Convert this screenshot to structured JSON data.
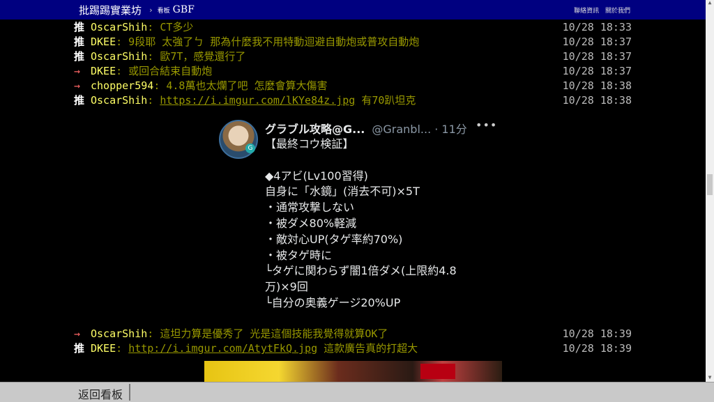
{
  "header": {
    "board_title": "批踢踢實業坊",
    "separator": "›",
    "board_label": "看板",
    "board_name": "GBF",
    "links": [
      "聯絡資訊",
      "關於我們"
    ]
  },
  "pushes_top": [
    {
      "tag": "推",
      "user": "OscarShih",
      "content": ": CT多少",
      "time": "10/28 18:33"
    },
    {
      "tag": "推",
      "user": "DKEE",
      "content": ": 9段耶 太強了ㄅ 那為什麼我不用特動迴避自動炮或普攻自動炮",
      "time": "10/28 18:37"
    },
    {
      "tag": "推",
      "user": "OscarShih",
      "content": ": 歐7T，感覺還行了",
      "time": "10/28 18:37"
    },
    {
      "tag": "→",
      "user": "DKEE",
      "content": ": 或回合結束自動炮",
      "time": "10/28 18:37"
    },
    {
      "tag": "→",
      "user": "chopper594",
      "content": ": 4.8萬也太爛了吧  怎麼會算大傷害",
      "time": "10/28 18:38"
    },
    {
      "tag": "推",
      "user": "OscarShih",
      "content": ": ",
      "link": "https://i.imgur.com/lKYe84z.jpg",
      "after": " 有70趴坦克",
      "time": "10/28 18:38"
    }
  ],
  "tweet": {
    "name": "グラブル攻略@G...",
    "handle": "@Granbl... · 11分",
    "more": "•••",
    "avatar_badge": "G",
    "lines": [
      "【最終コウ検証】",
      "",
      "◆4アビ(Lv100習得)",
      "自身に「水鏡」(消去不可)×5T",
      "・通常攻撃しない",
      "・被ダメ80%軽減",
      "・敵対心UP(タゲ率約70%)",
      "・被タゲ時に",
      "└タゲに関わらず闇1倍ダメ(上限約4.8",
      "万)×9回",
      "└自分の奥義ゲージ20%UP"
    ]
  },
  "pushes_bottom": [
    {
      "tag": "→",
      "user": "OscarShih",
      "content": ": 這坦力算是優秀了 光是這個技能我覺得就算OK了",
      "time": "10/28 18:39"
    },
    {
      "tag": "推",
      "user": "DKEE",
      "content": ": ",
      "link": "http://i.imgur.com/AtytFkQ.jpg",
      "after": " 這款廣告真的打超大",
      "time": "10/28 18:39"
    }
  ],
  "footer": {
    "back_label": "返回看板"
  },
  "colors": {
    "header_bg": "#000080",
    "userid": "#ffff66",
    "content": "#999900",
    "arrow": "#ff6666"
  }
}
